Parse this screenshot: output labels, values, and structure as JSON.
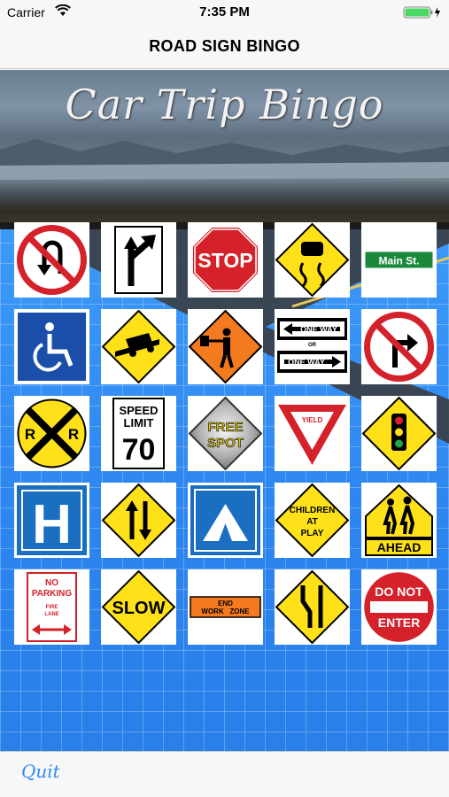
{
  "status_bar": {
    "carrier": "Carrier",
    "time": "7:35 PM"
  },
  "nav_bar": {
    "title": "ROAD SIGN BINGO"
  },
  "banner": {
    "title": "Car Trip Bingo"
  },
  "board": {
    "cells": [
      {
        "name": "no-u-turn"
      },
      {
        "name": "bear-right"
      },
      {
        "name": "stop",
        "text": "STOP"
      },
      {
        "name": "slippery-when-wet"
      },
      {
        "name": "street-name",
        "text": "Main St."
      },
      {
        "name": "handicapped-accessible"
      },
      {
        "name": "truck-on-hill"
      },
      {
        "name": "flagger-ahead"
      },
      {
        "name": "one-way",
        "text1": "ONE WAY",
        "or": "OR",
        "text2": "ONE WAY"
      },
      {
        "name": "no-right-turn"
      },
      {
        "name": "railroad-crossing",
        "l": "R",
        "r": "R"
      },
      {
        "name": "speed-limit",
        "line1": "SPEED",
        "line2": "LIMIT",
        "value": "70"
      },
      {
        "name": "free-spot",
        "line1": "FREE",
        "line2": "SPOT"
      },
      {
        "name": "yield",
        "text": "YIELD"
      },
      {
        "name": "traffic-signal-ahead"
      },
      {
        "name": "hospital",
        "text": "H"
      },
      {
        "name": "two-way-traffic"
      },
      {
        "name": "camping"
      },
      {
        "name": "children-at-play",
        "line1": "CHILDREN",
        "line2": "AT",
        "line3": "PLAY"
      },
      {
        "name": "school-crossing-ahead",
        "text": "AHEAD"
      },
      {
        "name": "no-parking",
        "line1": "NO",
        "line2": "PARKING",
        "line3": "FIRE",
        "line4": "LANE"
      },
      {
        "name": "slow",
        "text": "SLOW"
      },
      {
        "name": "end-work-zone",
        "line1": "END",
        "line2": "WORK   ZONE"
      },
      {
        "name": "road-narrows"
      },
      {
        "name": "do-not-enter",
        "line1": "DO NOT",
        "line2": "ENTER"
      }
    ]
  },
  "footer": {
    "quit_label": "Quit"
  }
}
